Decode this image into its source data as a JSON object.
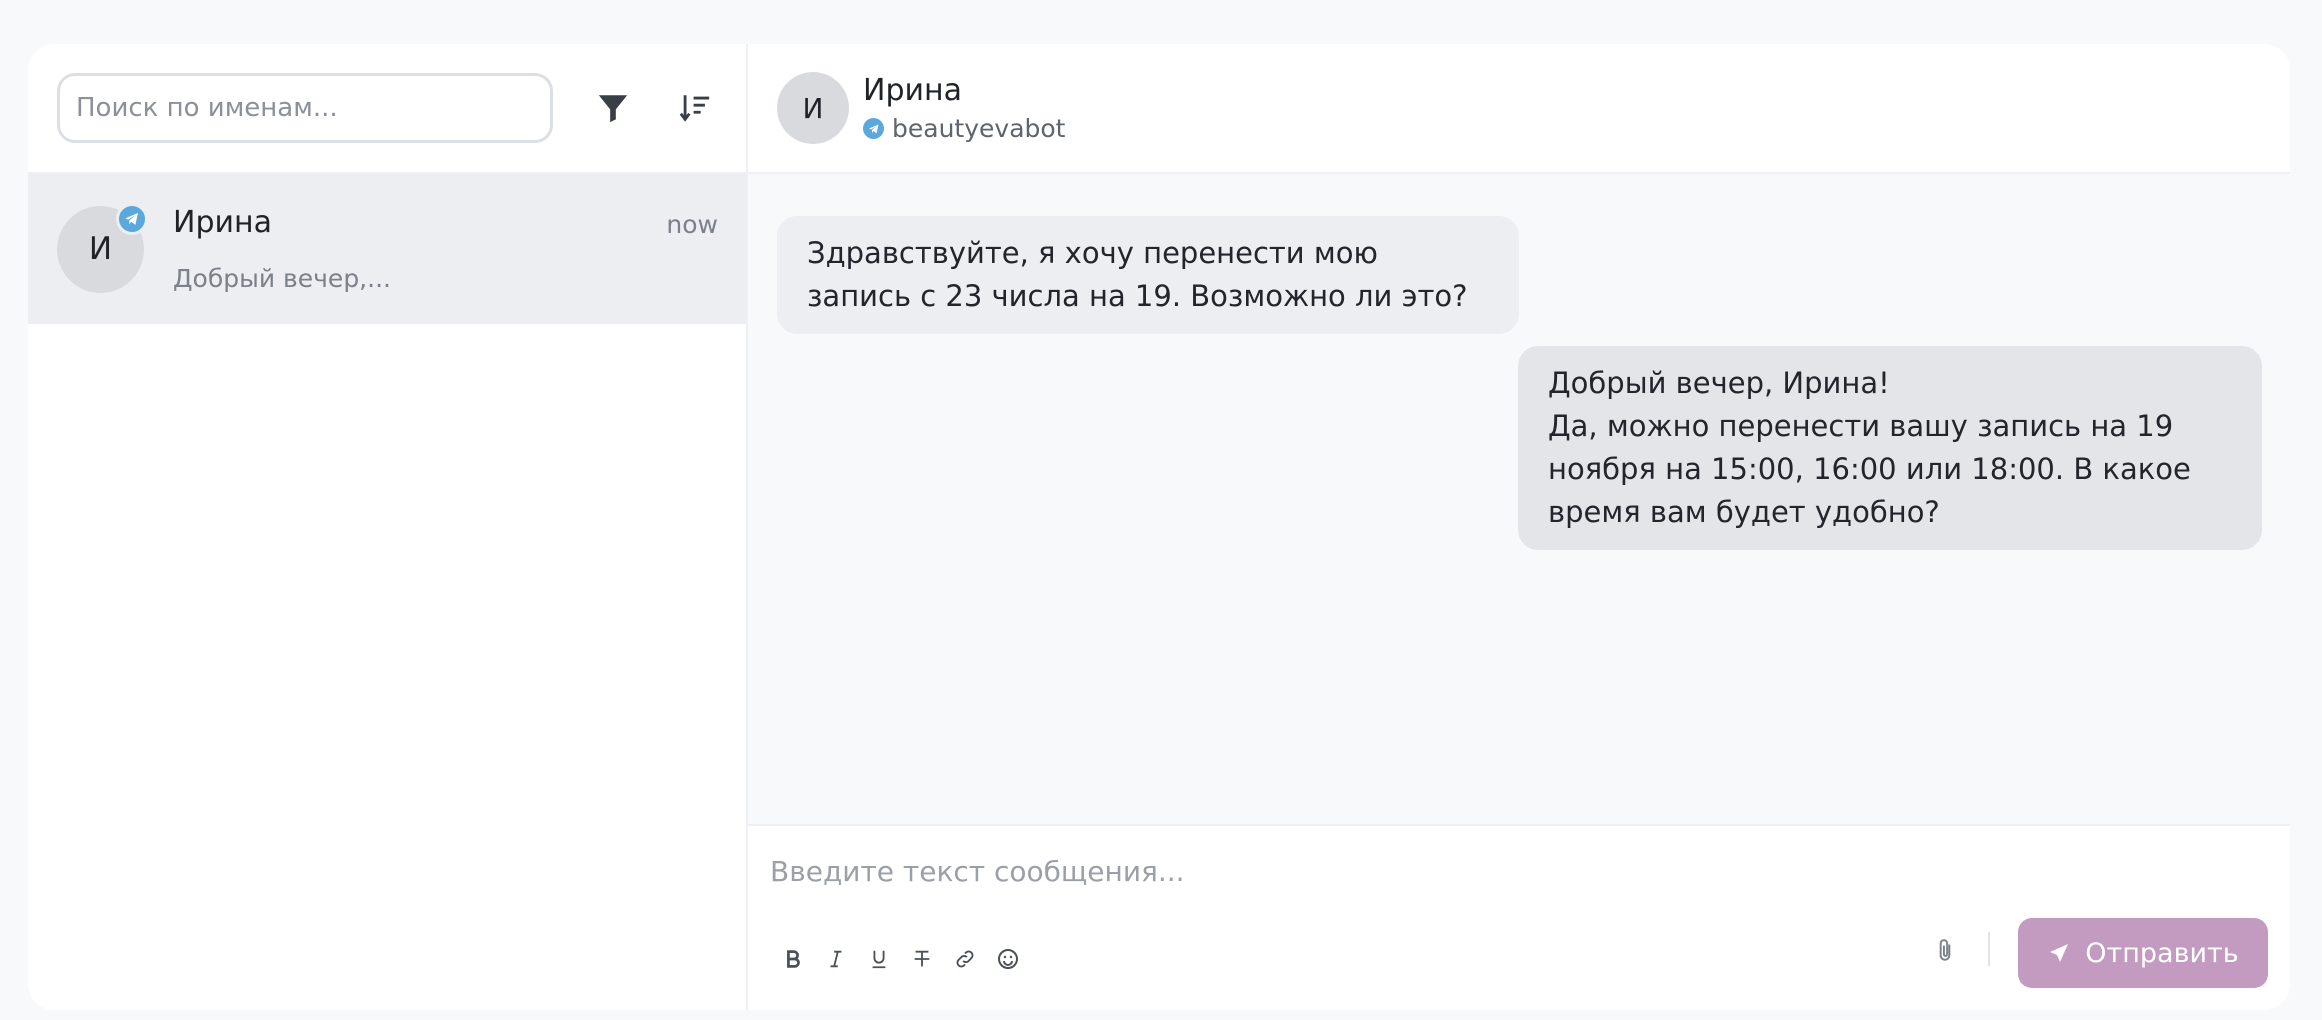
{
  "sidebar": {
    "search": {
      "placeholder": "Поиск по именам...",
      "value": ""
    },
    "filter_icon": "filter-icon",
    "sort_icon": "sort-icon",
    "chats": [
      {
        "avatar_letter": "И",
        "name": "Ирина",
        "preview": "Добрый вечер,...",
        "time": "now",
        "channel_icon": "telegram-icon"
      }
    ]
  },
  "header": {
    "avatar_letter": "И",
    "name": "Ирина",
    "channel": "beautyevabot",
    "channel_icon": "telegram-icon"
  },
  "messages": [
    {
      "direction": "incoming",
      "text": "Здравствуйте, я хочу перенести мою запись с 23 числа на 19. Возможно ли это?"
    },
    {
      "direction": "outgoing",
      "text": "Добрый вечер, Ирина!\nДа, можно перенести вашу запись на 19 ноября на 15:00, 16:00 или 18:00. В какое время вам будет удобно?"
    }
  ],
  "composer": {
    "placeholder": "Введите текст сообщения...",
    "value": "",
    "format_tools": [
      "bold-icon",
      "italic-icon",
      "underline-icon",
      "strikethrough-icon",
      "link-icon",
      "emoji-icon"
    ],
    "attach_icon": "paperclip-icon",
    "send_label": "Отправить"
  },
  "colors": {
    "accent": "#c39ac0",
    "telegram": "#5aa8dc",
    "selected_chat_bg": "#eceef1"
  }
}
